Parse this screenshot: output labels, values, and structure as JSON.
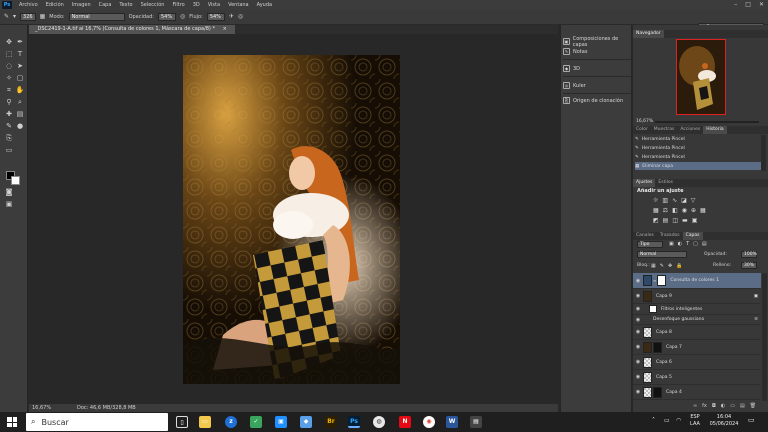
{
  "menu": {
    "logo": "Ps",
    "items": [
      "Archivo",
      "Edición",
      "Imagen",
      "Capa",
      "Texto",
      "Selección",
      "Filtro",
      "3D",
      "Vista",
      "Ventana",
      "Ayuda"
    ]
  },
  "options": {
    "brush_size": "326",
    "mode_label": "Modo:",
    "mode_value": "Normal",
    "opacity_label": "Opacidad:",
    "opacity_value": "54%",
    "flow_label": "Flujo:",
    "flow_value": "54%",
    "workspace_value": "sali"
  },
  "document": {
    "tab_title": "_DSC2419-1-A.tif al 16,7% (Consulta de colores 1, Máscara de capa/8) *",
    "zoom": "16,67%",
    "doc_size": "Doc: 46,6 MB/328,8 MB"
  },
  "dock": {
    "items": [
      "Composiciones de capas",
      "Notas",
      "3D",
      "Kuler",
      "Origen de clonación"
    ]
  },
  "navigator": {
    "tab": "Navegador",
    "zoom": "16,67%"
  },
  "history": {
    "tabs": [
      "Color",
      "Muestras",
      "Acciones",
      "Historia"
    ],
    "rows": [
      "Herramienta Pincel",
      "Herramienta Pincel",
      "Herramienta Pincel",
      "Eliminar capa"
    ]
  },
  "adjustments": {
    "tabs": [
      "Ajustes",
      "Estilos"
    ],
    "heading": "Añadir un ajuste"
  },
  "layers_panel": {
    "tabs": [
      "Canales",
      "Trazados",
      "Capas"
    ],
    "filter": "Tipo",
    "blend": "Normal",
    "opacity_label": "Opacidad:",
    "opacity": "100%",
    "lock_label": "Bloq.:",
    "fill_label": "Relleno:",
    "fill": "30%",
    "layers": [
      {
        "name": "Consulta de colores 1"
      },
      {
        "name": "Capa 9"
      },
      {
        "name": "Filtros inteligentes"
      },
      {
        "name": "Desenfoque gaussiano"
      },
      {
        "name": "Capa 8"
      },
      {
        "name": "Capa 7"
      },
      {
        "name": "Capa 6"
      },
      {
        "name": "Capa 5"
      },
      {
        "name": "Capa 4"
      }
    ]
  },
  "taskbar": {
    "search_placeholder": "Buscar",
    "lang_top": "ESP",
    "lang_bottom": "LAA",
    "time": "16:04",
    "date": "05/06/2024"
  }
}
